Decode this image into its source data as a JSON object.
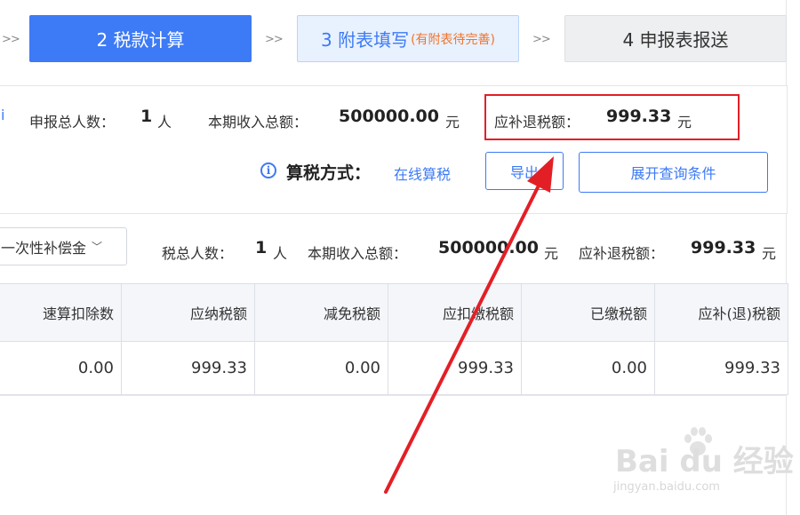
{
  "steps": {
    "sep1": ">>",
    "active": "2 税款计算",
    "sep2": ">>",
    "next": "3 附表填写",
    "next_note": "(有附表待完善)",
    "sep3": ">>",
    "last": "4 申报表报送"
  },
  "summary": {
    "left_mark": "i",
    "count_label": "申报总人数：",
    "count_value": "1",
    "count_unit": "人",
    "income_label": "本期收入总额：",
    "income_value": "500000.00",
    "income_unit": "元",
    "tax_label": "应补退税额：",
    "tax_value": "999.33",
    "tax_unit": "元"
  },
  "calc": {
    "icon": "i",
    "label": "算税方式：",
    "value": "在线算税"
  },
  "buttons": {
    "export": "导出",
    "expand": "展开查询条件"
  },
  "filter": {
    "dropdown_value": "一次性补偿金",
    "chevron": "﹀",
    "count_label": "税总人数：",
    "count_value": "1",
    "count_unit": "人",
    "income_label": "本期收入总额：",
    "income_value": "500000.00",
    "income_unit": "元",
    "tax_label": "应补退税额：",
    "tax_value": "999.33",
    "tax_unit": "元"
  },
  "table": {
    "headers": [
      "速算扣除数",
      "应纳税额",
      "减免税额",
      "应扣缴税额",
      "已缴税额",
      "应补(退)税额"
    ],
    "rows": [
      [
        "0.00",
        "999.33",
        "0.00",
        "999.33",
        "0.00",
        "999.33"
      ]
    ]
  },
  "watermark": {
    "logo": "Bai du 经验",
    "url": "jingyan.baidu.com"
  },
  "colors": {
    "primary": "#3d7af5",
    "highlight_red": "#e31f26",
    "note_orange": "#f0742c"
  }
}
